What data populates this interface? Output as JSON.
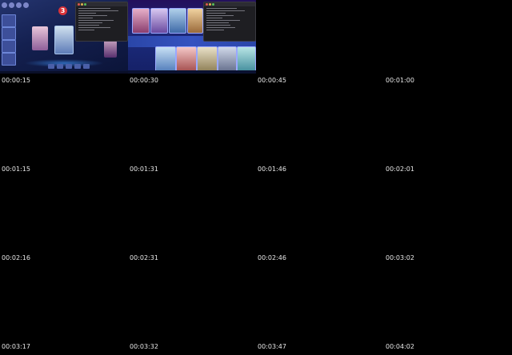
{
  "timestamps": [
    "00:00:15",
    "00:00:30",
    "00:00:45",
    "00:01:00",
    "00:01:15",
    "00:01:31",
    "00:01:46",
    "00:02:01",
    "00:02:16",
    "00:02:31",
    "00:02:46",
    "00:03:02",
    "00:03:17",
    "00:03:32",
    "00:03:47",
    "00:04:02"
  ],
  "frame1": {
    "badge": "3"
  },
  "colors": {
    "background": "#000000",
    "timestamp_text": "#e8e8e8",
    "lobby_bg": "#142050",
    "select_bg": "#1b2a7a",
    "badge_red": "#d8333a"
  }
}
